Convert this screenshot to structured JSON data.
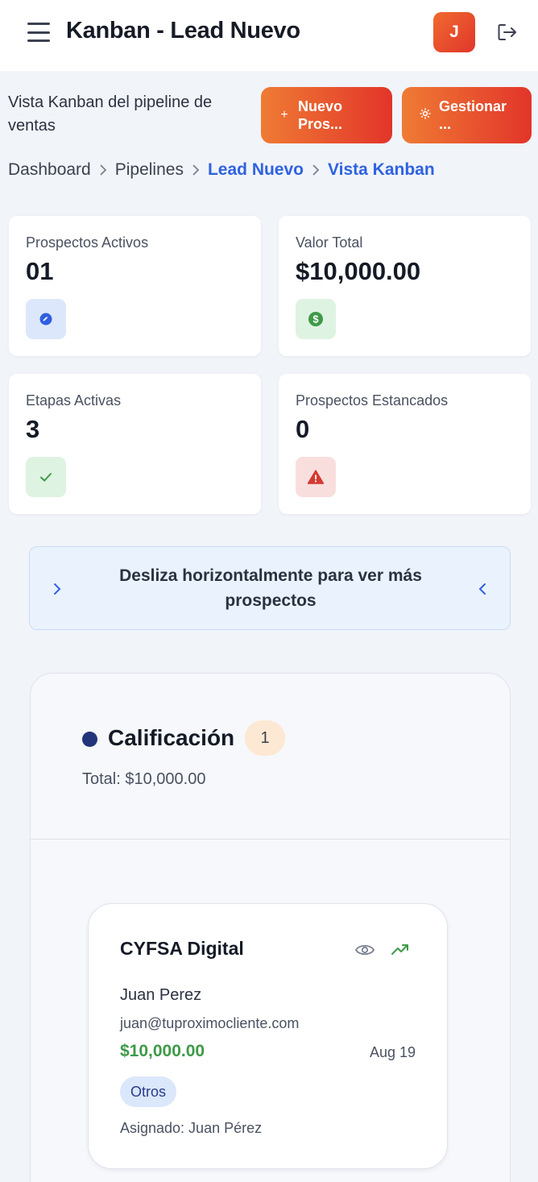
{
  "header": {
    "title": "Kanban - Lead Nuevo",
    "avatar_initial": "J"
  },
  "page": {
    "subtitle": "Vista Kanban del pipeline de ventas",
    "new_button": "Nuevo\nPros...",
    "manage_button": "Gestionar\n..."
  },
  "breadcrumb": [
    "Dashboard",
    "Pipelines",
    "Lead Nuevo",
    "Vista Kanban"
  ],
  "stats": [
    {
      "label": "Prospectos Activos",
      "value": "01",
      "icon": "users-icon",
      "color": "#2f5fe0",
      "bg": "#dde7fb"
    },
    {
      "label": "Valor Total",
      "value": "$10,000.00",
      "icon": "dollar-icon",
      "color": "#3e9a48",
      "bg": "#dff3e2"
    },
    {
      "label": "Etapas Activas",
      "value": "3",
      "icon": "check-icon",
      "color": "#3e9a48",
      "bg": "#dff3e2"
    },
    {
      "label": "Prospectos Estancados",
      "value": "0",
      "icon": "warning-icon",
      "color": "#d33a32",
      "bg": "#f9dede"
    }
  ],
  "swipe_hint": "Desliza horizontalmente para ver más prospectos",
  "column": {
    "title": "Calificación",
    "count": "1",
    "total": "Total: $10,000.00",
    "dot_color": "#23357a"
  },
  "card": {
    "company": "CYFSA Digital",
    "contact": "Juan Perez",
    "email": "juan@tuproximocliente.com",
    "amount": "$10,000.00",
    "date": "Aug 19",
    "tag": "Otros",
    "assigned": "Asignado: Juan Pérez"
  },
  "colors": {
    "accent": "#e2352a",
    "link": "#2f62e0",
    "money": "#3e9a48"
  }
}
